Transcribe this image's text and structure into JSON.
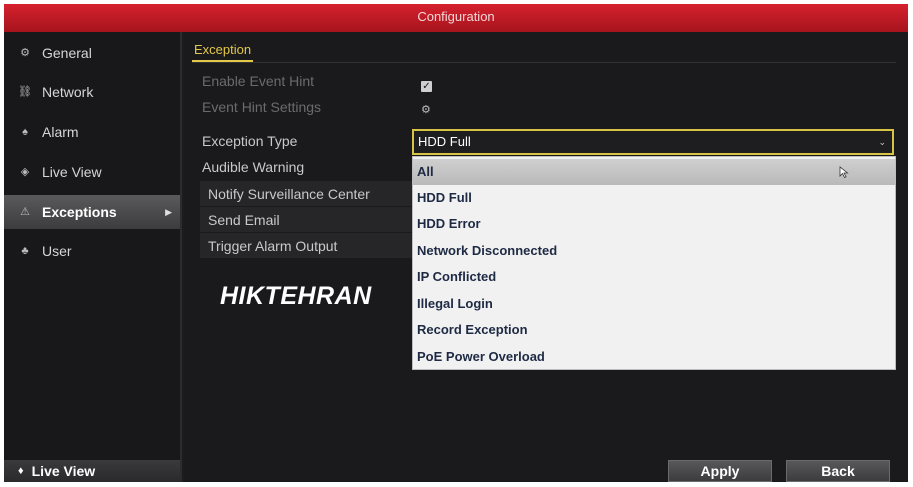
{
  "window": {
    "title": "Configuration"
  },
  "sidebar": {
    "items": [
      {
        "label": "General",
        "icon": "gear-icon",
        "glyph": "⚙"
      },
      {
        "label": "Network",
        "icon": "network-icon",
        "glyph": "⛓"
      },
      {
        "label": "Alarm",
        "icon": "alarm-icon",
        "glyph": "♠"
      },
      {
        "label": "Live View",
        "icon": "eye-icon",
        "glyph": "◈"
      },
      {
        "label": "Exceptions",
        "icon": "warning-icon",
        "glyph": "⚠"
      },
      {
        "label": "User",
        "icon": "users-icon",
        "glyph": "♣"
      }
    ],
    "active": "Exceptions",
    "footer": {
      "label": "Live View",
      "glyph": "♦"
    }
  },
  "main": {
    "tab": "Exception",
    "settings": {
      "enable_event_hint": "Enable Event Hint",
      "event_hint_settings": "Event Hint Settings",
      "exception_type": "Exception Type",
      "audible_warning": "Audible Warning",
      "notify_surveillance_center": "Notify Surveillance Center",
      "send_email": "Send Email",
      "trigger_alarm_output": "Trigger Alarm Output"
    },
    "enable_event_hint_checked": true,
    "exception_type_select": {
      "value": "HDD Full",
      "options": [
        "All",
        "HDD Full",
        "HDD Error",
        "Network Disconnected",
        "IP Conflicted",
        "Illegal Login",
        "Record Exception",
        "PoE Power Overload"
      ],
      "highlighted": "All"
    },
    "watermark": "HIKTEHRAN"
  },
  "buttons": {
    "apply": "Apply",
    "back": "Back"
  },
  "colors": {
    "titlebar": "#c61a26",
    "accent_tab": "#e3c84a",
    "select_border": "#d8c444"
  }
}
